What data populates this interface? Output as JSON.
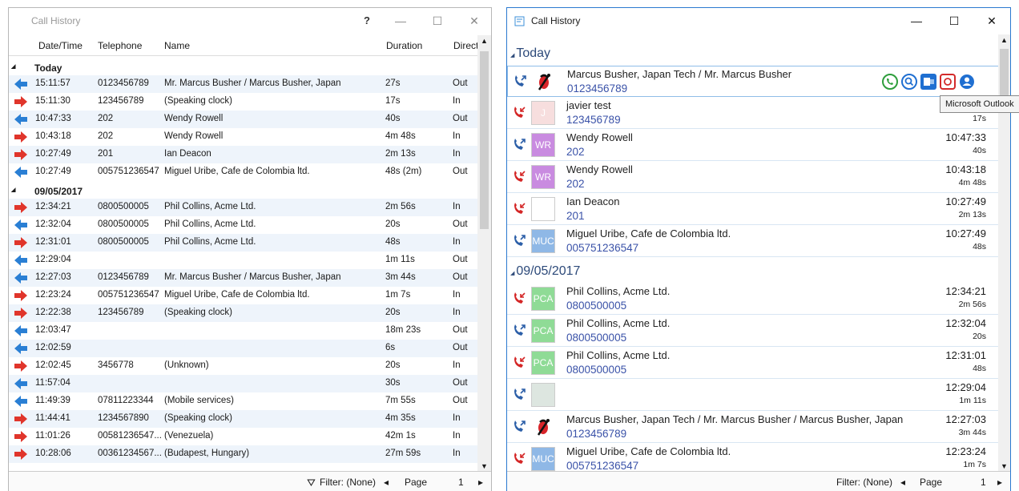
{
  "left": {
    "title": "Call History",
    "help": "?",
    "columns": {
      "datetime": "Date/Time",
      "telephone": "Telephone",
      "name": "Name",
      "duration": "Duration",
      "direction": "Direct"
    },
    "groups": [
      {
        "label": "Today",
        "rows": [
          {
            "time": "15:11:57",
            "tel": "0123456789",
            "name": "Mr. Marcus Busher / Marcus Busher, Japan",
            "dur": "27s",
            "dir": "Out"
          },
          {
            "time": "15:11:30",
            "tel": "123456789",
            "name": "(Speaking clock)",
            "dur": "17s",
            "dir": "In"
          },
          {
            "time": "10:47:33",
            "tel": "202",
            "name": "Wendy Rowell",
            "dur": "40s",
            "dir": "Out"
          },
          {
            "time": "10:43:18",
            "tel": "202",
            "name": "Wendy Rowell",
            "dur": "4m 48s",
            "dir": "In"
          },
          {
            "time": "10:27:49",
            "tel": "201",
            "name": "Ian Deacon",
            "dur": "2m 13s",
            "dir": "In"
          },
          {
            "time": "10:27:49",
            "tel": "005751236547",
            "name": "Miguel Uribe, Cafe de Colombia ltd.",
            "dur": "48s (2m)",
            "dir": "Out"
          }
        ]
      },
      {
        "label": "09/05/2017",
        "rows": [
          {
            "time": "12:34:21",
            "tel": "0800500005",
            "name": "Phil Collins, Acme Ltd.",
            "dur": "2m 56s",
            "dir": "In"
          },
          {
            "time": "12:32:04",
            "tel": "0800500005",
            "name": "Phil Collins, Acme Ltd.",
            "dur": "20s",
            "dir": "Out"
          },
          {
            "time": "12:31:01",
            "tel": "0800500005",
            "name": "Phil Collins, Acme Ltd.",
            "dur": "48s",
            "dir": "In"
          },
          {
            "time": "12:29:04",
            "tel": "",
            "name": "",
            "dur": "1m 11s",
            "dir": "Out"
          },
          {
            "time": "12:27:03",
            "tel": "0123456789",
            "name": "Mr. Marcus Busher / Marcus Busher, Japan",
            "dur": "3m 44s",
            "dir": "Out"
          },
          {
            "time": "12:23:24",
            "tel": "005751236547",
            "name": "Miguel Uribe, Cafe de Colombia ltd.",
            "dur": "1m 7s",
            "dir": "In"
          },
          {
            "time": "12:22:38",
            "tel": "123456789",
            "name": "(Speaking clock)",
            "dur": "20s",
            "dir": "In"
          },
          {
            "time": "12:03:47",
            "tel": "",
            "name": "",
            "dur": "18m 23s",
            "dir": "Out"
          },
          {
            "time": "12:02:59",
            "tel": "",
            "name": "",
            "dur": "6s",
            "dir": "Out"
          },
          {
            "time": "12:02:45",
            "tel": "3456778",
            "name": "(Unknown)",
            "dur": "20s",
            "dir": "In"
          },
          {
            "time": "11:57:04",
            "tel": "",
            "name": "",
            "dur": "30s",
            "dir": "Out"
          },
          {
            "time": "11:49:39",
            "tel": "07811223344",
            "name": "(Mobile services)",
            "dur": "7m 55s",
            "dir": "Out"
          },
          {
            "time": "11:44:41",
            "tel": "1234567890",
            "name": "(Speaking clock)",
            "dur": "4m 35s",
            "dir": "In"
          },
          {
            "time": "11:01:26",
            "tel": "00581236547...",
            "name": "(Venezuela)",
            "dur": "42m 1s",
            "dir": "In"
          },
          {
            "time": "10:28:06",
            "tel": "00361234567...",
            "name": "(Budapest, Hungary)",
            "dur": "27m 59s",
            "dir": "In"
          }
        ]
      }
    ],
    "footer": {
      "filter": "Filter: (None)",
      "page_label": "Page",
      "page_num": "1"
    }
  },
  "right": {
    "title": "Call History",
    "tooltip": "Microsoft Outlook",
    "groups": [
      {
        "label": "Today",
        "rows": [
          {
            "name": "Marcus Busher, Japan Tech / Mr. Marcus Busher",
            "tel": "0123456789",
            "time": "",
            "dur": "",
            "dir": "out",
            "avatar": "",
            "avatar_color": "#ffffff",
            "avatar_type": "photo"
          },
          {
            "name": "javier test",
            "tel": "123456789",
            "time": "",
            "dur": "17s",
            "dir": "in",
            "avatar": "J",
            "avatar_color": "#f7dede",
            "avatar_type": "text"
          },
          {
            "name": "Wendy Rowell",
            "tel": "202",
            "time": "10:47:33",
            "dur": "40s",
            "dir": "out",
            "avatar": "WR",
            "avatar_color": "#c98be0",
            "avatar_type": "text"
          },
          {
            "name": "Wendy Rowell",
            "tel": "202",
            "time": "10:43:18",
            "dur": "4m 48s",
            "dir": "in",
            "avatar": "WR",
            "avatar_color": "#c98be0",
            "avatar_type": "text"
          },
          {
            "name": "Ian Deacon",
            "tel": "201",
            "time": "10:27:49",
            "dur": "2m 13s",
            "dir": "in",
            "avatar": "",
            "avatar_color": "#ffffff",
            "avatar_type": "text"
          },
          {
            "name": "Miguel Uribe, Cafe de Colombia ltd.",
            "tel": "005751236547",
            "time": "10:27:49",
            "dur": "48s",
            "dir": "out",
            "avatar": "MUC",
            "avatar_color": "#8fb8e6",
            "avatar_type": "text"
          }
        ]
      },
      {
        "label": "09/05/2017",
        "rows": [
          {
            "name": "Phil Collins, Acme Ltd.",
            "tel": "0800500005",
            "time": "12:34:21",
            "dur": "2m 56s",
            "dir": "in",
            "avatar": "PCA",
            "avatar_color": "#8fdb96",
            "avatar_type": "text"
          },
          {
            "name": "Phil Collins, Acme Ltd.",
            "tel": "0800500005",
            "time": "12:32:04",
            "dur": "20s",
            "dir": "out",
            "avatar": "PCA",
            "avatar_color": "#8fdb96",
            "avatar_type": "text"
          },
          {
            "name": "Phil Collins, Acme Ltd.",
            "tel": "0800500005",
            "time": "12:31:01",
            "dur": "48s",
            "dir": "in",
            "avatar": "PCA",
            "avatar_color": "#8fdb96",
            "avatar_type": "text"
          },
          {
            "name": "",
            "tel": "",
            "time": "12:29:04",
            "dur": "1m 11s",
            "dir": "out",
            "avatar": "",
            "avatar_color": "#dde6e0",
            "avatar_type": "text"
          },
          {
            "name": "Marcus Busher, Japan Tech / Mr. Marcus Busher / Marcus Busher, Japan",
            "tel": "0123456789",
            "time": "12:27:03",
            "dur": "3m 44s",
            "dir": "out",
            "avatar": "",
            "avatar_color": "#ffffff",
            "avatar_type": "photo"
          },
          {
            "name": "Miguel Uribe, Cafe de Colombia ltd.",
            "tel": "005751236547",
            "time": "12:23:24",
            "dur": "1m 7s",
            "dir": "in",
            "avatar": "MUC",
            "avatar_color": "#8fb8e6",
            "avatar_type": "text"
          }
        ]
      }
    ],
    "footer": {
      "filter": "Filter: (None)",
      "page_label": "Page",
      "page_num": "1"
    }
  },
  "colors": {
    "in": "#e0352b",
    "out": "#2a7fd4",
    "accent": "#2b79d0",
    "phone_in": "#d42626",
    "phone_out": "#2c5fa8"
  }
}
